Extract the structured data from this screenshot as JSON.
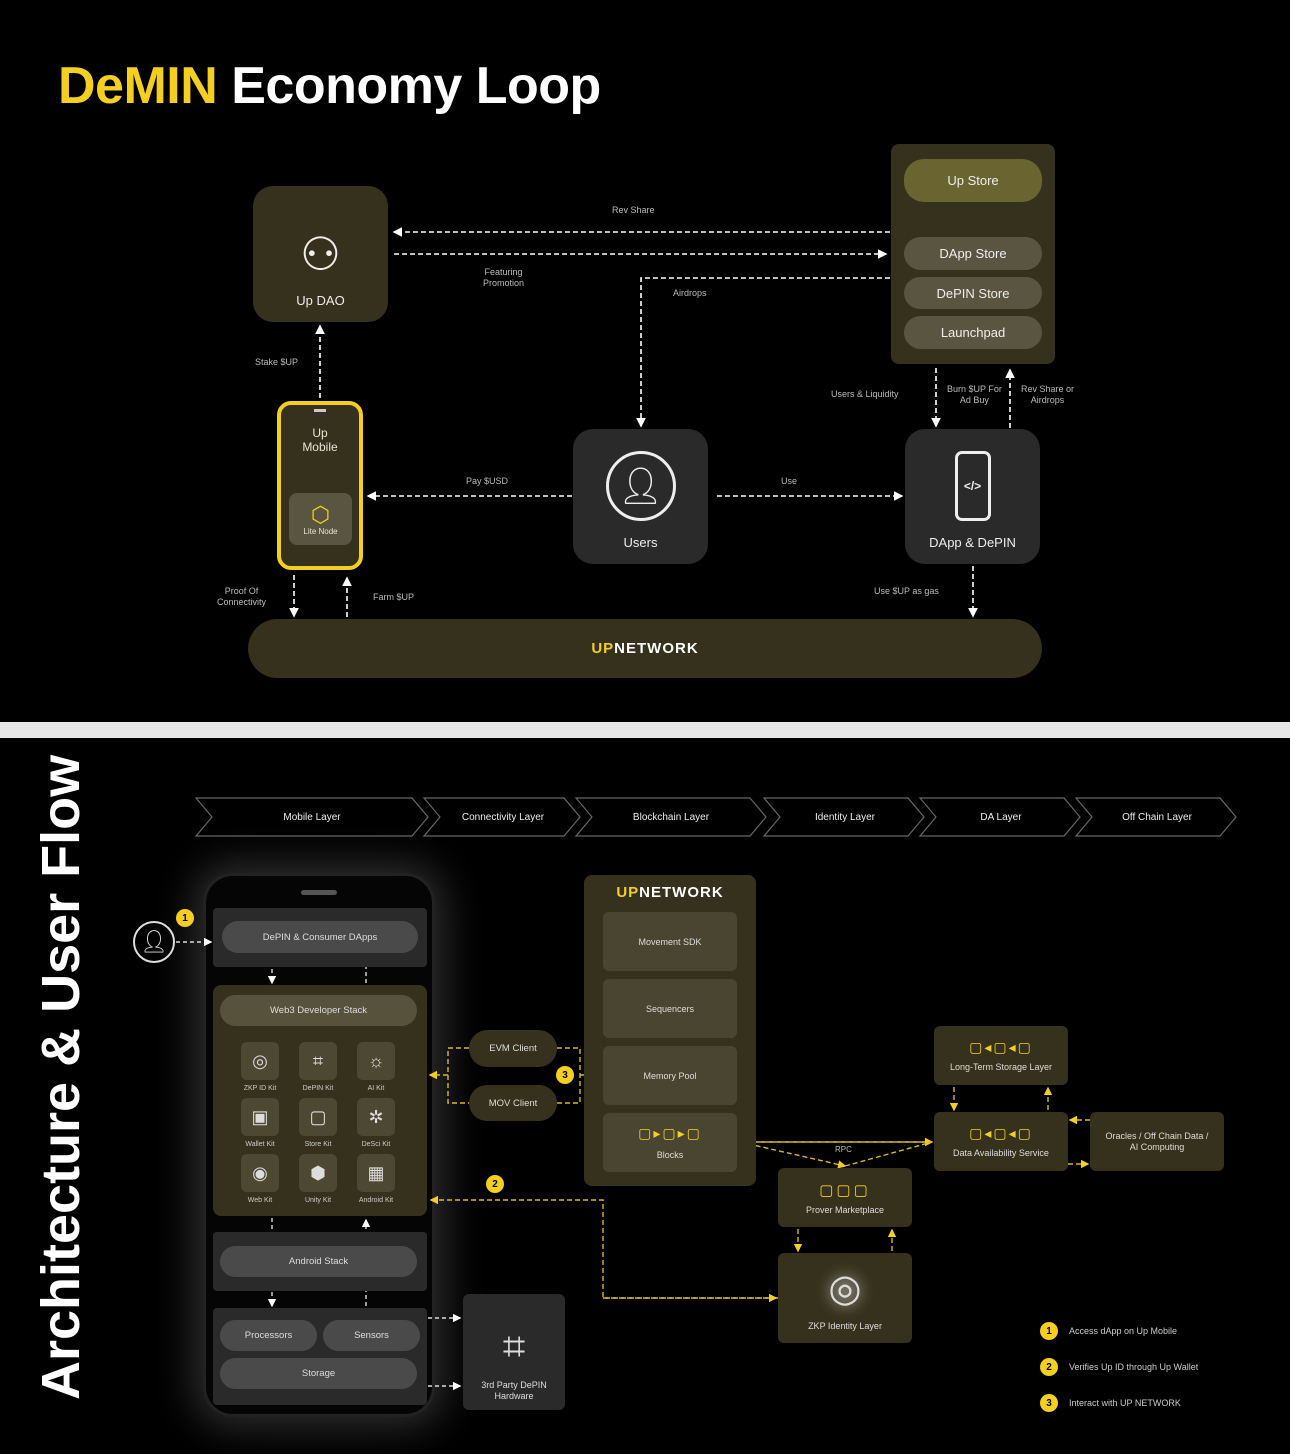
{
  "colors": {
    "accent": "#f5cf1f",
    "box": "#35311c",
    "background": "#000000"
  },
  "top": {
    "title_highlight": "DeMIN",
    "title_rest": "Economy Loop",
    "up_dao": "Up DAO",
    "store": {
      "up_store": "Up Store",
      "items": [
        "DApp Store",
        "DePIN Store",
        "Launchpad"
      ]
    },
    "up_mobile": "Up\nMobile",
    "lite_node": "Lite Node",
    "users": "Users",
    "dapp_depin": "DApp & DePIN",
    "network_logo": {
      "a": "U",
      "b": "P",
      "c": "NETWORK"
    },
    "labels": {
      "rev_share": "Rev Share",
      "featuring": "Featuring\nPromotion",
      "airdrops": "Airdrops",
      "stake": "Stake $UP",
      "users_liquidity": "Users & Liquidity",
      "burn": "Burn $UP For\nAd Buy",
      "rev_share_airdrops": "Rev Share or\nAirdrops",
      "pay": "Pay $USD",
      "use": "Use",
      "proof": "Proof Of\nConnectivity",
      "farm": "Farm $UP",
      "gas": "Use $UP as gas"
    }
  },
  "bottom": {
    "title": "Architecture & User Flow",
    "layers": [
      "Mobile Layer",
      "Connectivity Layer",
      "Blockchain Layer",
      "Identity Layer",
      "DA Layer",
      "Off Chain Layer"
    ],
    "phone": {
      "dapps": "DePIN & Consumer DApps",
      "web3": "Web3 Developer Stack",
      "kits": [
        {
          "name": "ZKP ID Kit",
          "icon": "fingerprint-icon",
          "g": "◎"
        },
        {
          "name": "DePIN Kit",
          "icon": "chip-icon",
          "g": "⌗"
        },
        {
          "name": "AI Kit",
          "icon": "ai-bulb-icon",
          "g": "☼"
        },
        {
          "name": "Wallet Kit",
          "icon": "wallet-icon",
          "g": "▣"
        },
        {
          "name": "Store Kit",
          "icon": "store-bag-icon",
          "g": "▢"
        },
        {
          "name": "DeSci Kit",
          "icon": "desci-icon",
          "g": "✲"
        },
        {
          "name": "Web Kit",
          "icon": "compass-icon",
          "g": "◉"
        },
        {
          "name": "Unity Kit",
          "icon": "unity-icon",
          "g": "⬢"
        },
        {
          "name": "Android Kit",
          "icon": "android-icon",
          "g": "▦"
        }
      ],
      "android": "Android Stack",
      "processors": "Processors",
      "sensors": "Sensors",
      "storage": "Storage"
    },
    "evm": "EVM Client",
    "mov": "MOV Client",
    "network": {
      "items": [
        "Movement SDK",
        "Sequencers",
        "Memory Pool"
      ],
      "blocks": "Blocks"
    },
    "hardware": "3rd Party DePIN\nHardware",
    "rpc": "RPC",
    "prover": "Prover Marketplace",
    "zkp": "ZKP Identity Layer",
    "lts": "Long-Term Storage Layer",
    "das": "Data Availability Service",
    "oracles": "Oracles / Off Chain Data /\nAI Computing",
    "legend": [
      {
        "n": "1",
        "text": "Access dApp on Up Mobile"
      },
      {
        "n": "2",
        "text": "Verifies Up ID through Up Wallet"
      },
      {
        "n": "3",
        "text": "Interact with UP NETWORK"
      }
    ]
  }
}
